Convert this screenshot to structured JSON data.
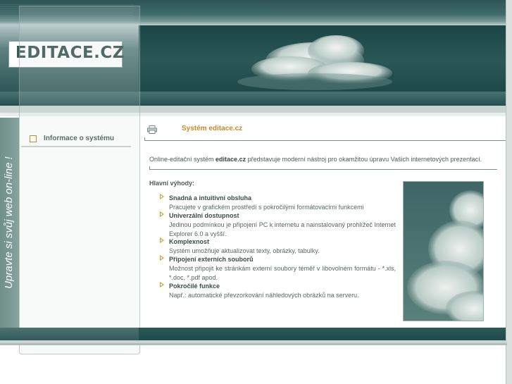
{
  "header": {
    "logo_text": "EDITACE.CZ"
  },
  "slogan": "Upravte si svůj web on-line !",
  "sidebar": {
    "items": [
      {
        "label": "Informace o systému"
      }
    ]
  },
  "main": {
    "title": "Systém editace.cz",
    "intro_prefix": "Online-editační systém ",
    "intro_brand": "editace.cz",
    "intro_suffix": " představuje moderní nástroj pro okamžitou úpravu Vašich internetových prezentací.",
    "advantages_heading": "Hlavní výhody:",
    "features": [
      {
        "title": "Snadná a intuitivní obsluha",
        "desc": "Pracujete  v grafickém prostředí s pokročilými formátovacími funkcemi"
      },
      {
        "title": "Univerzální dostupnost",
        "desc": "Jedinou podmínkou je připojení PC k internetu a nainstalovaný prohlížeč Internet Explorer 6.0 a vyšší."
      },
      {
        "title": "Komplexnost",
        "desc": "Systém umožňuje aktualizovat texty, obrázky, tabulky."
      },
      {
        "title": "Připojení externích souborů",
        "desc": "Možnost připojit ke stránkám externí soubory téměř v libovolném formátu - *.xls, *.doc, *.pdf apod."
      },
      {
        "title": "Pokročilé funkce",
        "desc": "Např.: automatické převzorkování náhledových obrázků na serveru."
      }
    ]
  },
  "colors": {
    "accent": "#c6892a",
    "header_dark": "#2b5757",
    "strip": "#7a9993"
  },
  "icons": {
    "print": "printer-icon",
    "bullet": "square-bullet-icon",
    "feature_marker": "triangle-right-icon"
  }
}
